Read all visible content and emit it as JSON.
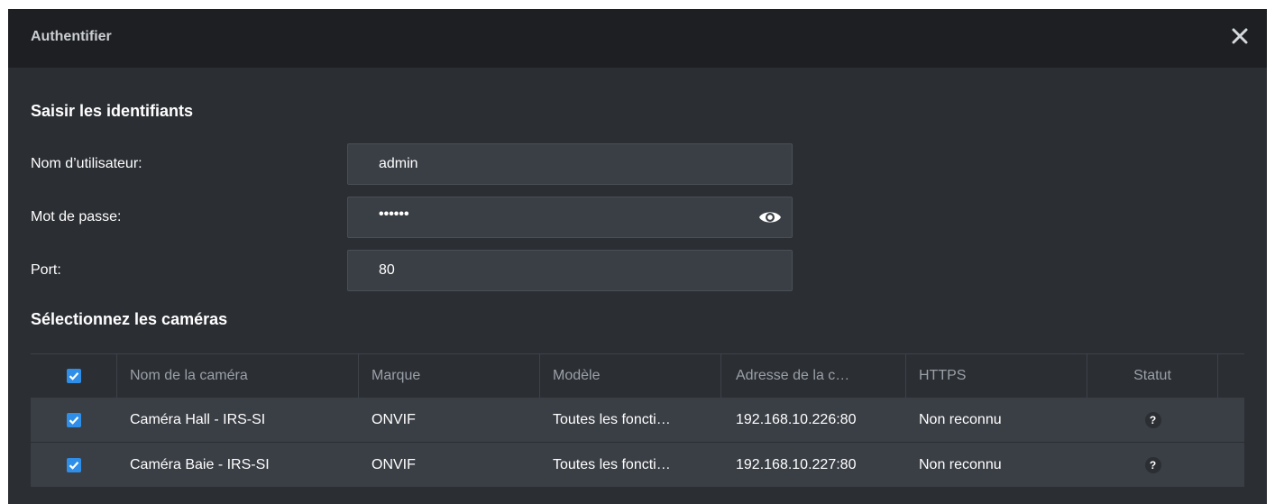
{
  "dialog": {
    "title": "Authentifier",
    "close_icon": "close-icon"
  },
  "credentials": {
    "section_title": "Saisir les identifiants",
    "username_label": "Nom d’utilisateur:",
    "username_value": "admin",
    "password_label": "Mot de passe:",
    "password_value": "••••••",
    "password_toggle_icon": "eye-icon",
    "port_label": "Port:",
    "port_value": "80"
  },
  "cameras": {
    "section_title": "Sélectionnez les caméras",
    "columns": [
      "Nom de la caméra",
      "Marque",
      "Modèle",
      "Adresse de la c…",
      "HTTPS",
      "Statut"
    ],
    "select_all_checked": true,
    "rows": [
      {
        "checked": true,
        "name": "Caméra Hall - IRS-SI",
        "brand": "ONVIF",
        "model": "Toutes les foncti…",
        "address": "192.168.10.226:80",
        "https": "Non reconnu",
        "status": "?"
      },
      {
        "checked": true,
        "name": "Caméra Baie - IRS-SI",
        "brand": "ONVIF",
        "model": "Toutes les foncti…",
        "address": "192.168.10.227:80",
        "https": "Non reconnu",
        "status": "?"
      }
    ]
  },
  "colors": {
    "background": "#2b2e33",
    "titlebar": "#1d1f22",
    "input": "#3a3e45",
    "checkbox": "#2f8fe8"
  }
}
